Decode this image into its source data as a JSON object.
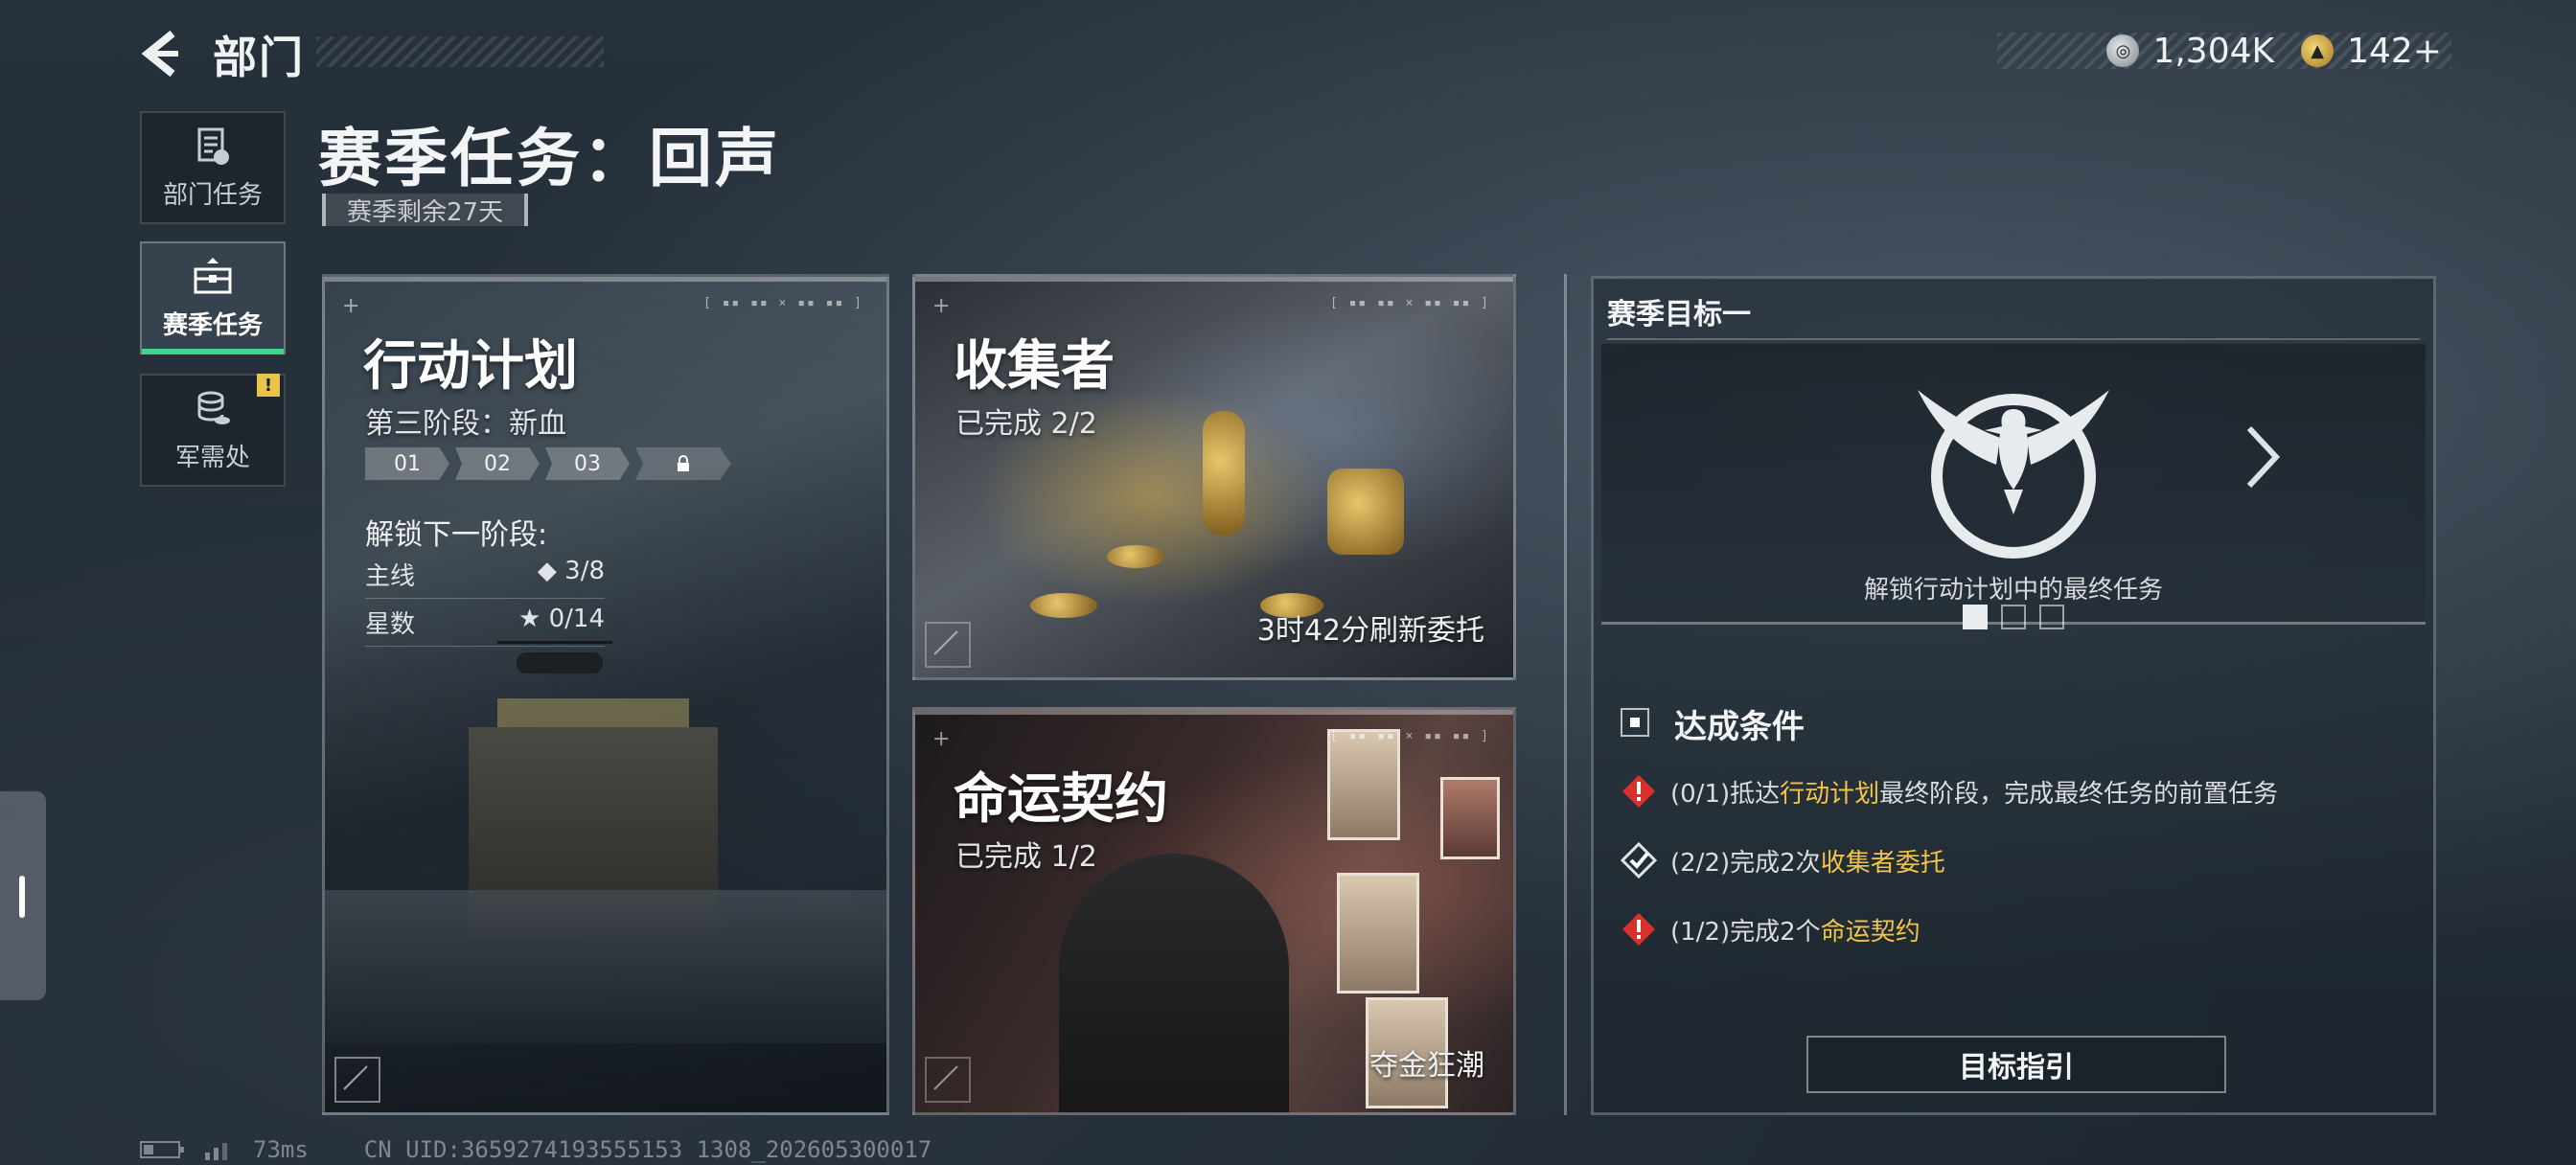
{
  "header": {
    "back_icon": "chevron-left-icon",
    "title": "部门"
  },
  "currency": {
    "silver": {
      "icon": "silver-coin-icon",
      "value": "1,304K"
    },
    "gold": {
      "icon": "gold-coin-icon",
      "value": "142+"
    }
  },
  "sidebar": {
    "items": [
      {
        "label": "部门任务",
        "icon": "document-icon",
        "active": false
      },
      {
        "label": "赛季任务",
        "icon": "briefcase-icon",
        "active": true
      },
      {
        "label": "军需处",
        "icon": "coins-stack-icon",
        "active": false,
        "badge": "!"
      }
    ]
  },
  "season": {
    "title": "赛季任务：回声",
    "remaining": "赛季剩余27天"
  },
  "cards": {
    "plan": {
      "title": "行动计划",
      "stage_label": "第三阶段：新血",
      "stages": [
        "01",
        "02",
        "03"
      ],
      "lock_icon": "lock-icon",
      "unlock_title": "解锁下一阶段:",
      "requirements": [
        {
          "label": "主线",
          "icon": "diamond-icon",
          "value": "3/8"
        },
        {
          "label": "星数",
          "icon": "star-icon",
          "value": "0/14"
        }
      ]
    },
    "collector": {
      "title": "收集者",
      "progress": "已完成 2/2",
      "refresh": "3时42分刷新委托"
    },
    "fate": {
      "title": "命运契约",
      "progress": "已完成 1/2",
      "footer": "夺金狂潮"
    }
  },
  "goal": {
    "heading": "赛季目标一",
    "emblem_icon": "eagle-emblem-icon",
    "caption": "解锁行动计划中的最终任务",
    "page_count": 3,
    "active_page": 1,
    "condition_title": "达成条件",
    "conditions": [
      {
        "status": "incomplete",
        "icon": "warning-diamond-icon",
        "prefix": "(0/1)抵达",
        "highlight": "行动计划",
        "suffix": "最终阶段，完成最终任务的前置任务"
      },
      {
        "status": "complete",
        "icon": "check-diamond-icon",
        "prefix": "(2/2)完成2次",
        "highlight": "收集者委托",
        "suffix": ""
      },
      {
        "status": "incomplete",
        "icon": "warning-diamond-icon",
        "prefix": "(1/2)完成2个",
        "highlight": "命运契约",
        "suffix": ""
      }
    ],
    "guide_button": "目标指引"
  },
  "status": {
    "ping": "73ms",
    "uid": "CN UID:3659274193555153 1308_202605300017"
  },
  "colors": {
    "accent_green": "#3fd58a",
    "highlight_gold": "#f1c54a",
    "warn_red": "#d9302b"
  }
}
